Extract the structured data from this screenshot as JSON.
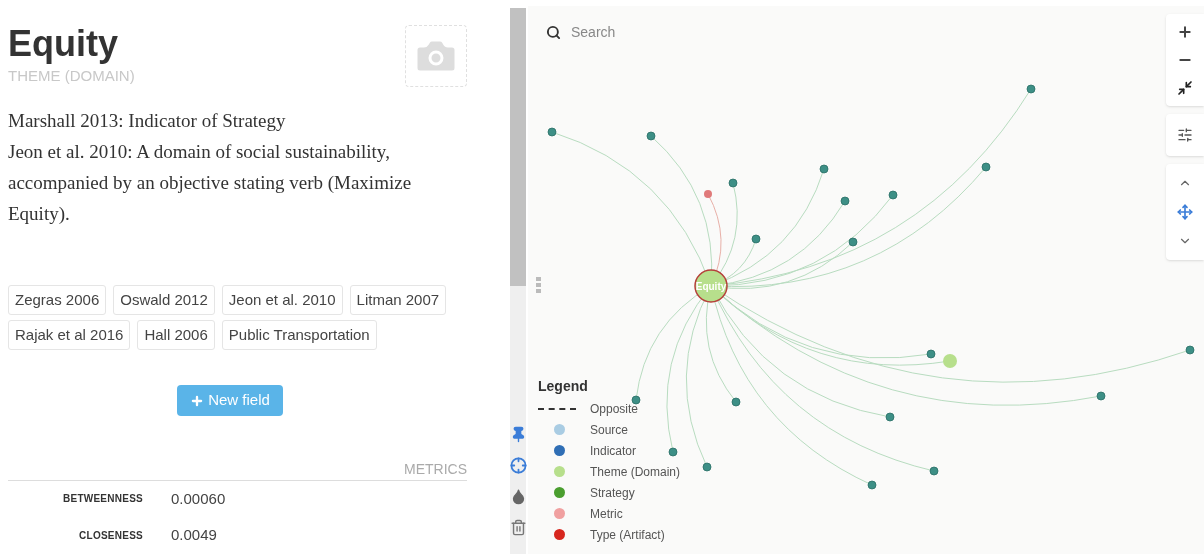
{
  "node": {
    "title": "Equity",
    "type": "THEME (DOMAIN)",
    "description": [
      "Marshall 2013: Indicator of Strategy",
      "Jeon et al. 2010: A domain of social sustainability, accompanied by an objective stating verb (Maximize Equity)."
    ],
    "tags": [
      "Zegras 2006",
      "Oswald 2012",
      "Jeon et al. 2010",
      "Litman 2007",
      "Rajak et al 2016",
      "Hall 2006",
      "Public Transportation"
    ],
    "new_field_button": "New field",
    "metrics": {
      "heading": "METRICS",
      "rows": [
        {
          "label": "BETWEENNESS",
          "value": "0.00060"
        },
        {
          "label": "CLOSENESS",
          "value": "0.0049"
        }
      ]
    }
  },
  "graph": {
    "search": {
      "placeholder": "Search"
    },
    "center_label": "Equity",
    "legend": {
      "title": "Legend",
      "items": [
        {
          "kind": "line",
          "label": "Opposite"
        },
        {
          "kind": "dot",
          "label": "Source",
          "color": "#a9cce3"
        },
        {
          "kind": "dot",
          "label": "Indicator",
          "color": "#2f6eb5"
        },
        {
          "kind": "dot",
          "label": "Theme (Domain)",
          "color": "#b7df8c"
        },
        {
          "kind": "dot",
          "label": "Strategy",
          "color": "#4a9e2f"
        },
        {
          "kind": "dot",
          "label": "Metric",
          "color": "#f0a0a0"
        },
        {
          "kind": "dot",
          "label": "Type (Artifact)",
          "color": "#d7261e"
        }
      ]
    }
  }
}
